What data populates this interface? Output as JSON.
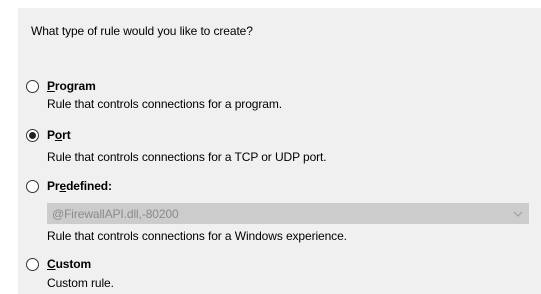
{
  "question": "What type of rule would you like to create?",
  "options": [
    {
      "id": "program",
      "label_prefix": "",
      "label_accel": "P",
      "label_rest": "rogram",
      "description": "Rule that controls connections for a program.",
      "selected": false
    },
    {
      "id": "port",
      "label_prefix": "P",
      "label_accel": "o",
      "label_rest": "rt",
      "description": "Rule that controls connections for a TCP or UDP port.",
      "selected": true
    },
    {
      "id": "predefined",
      "label_prefix": "Pr",
      "label_accel": "e",
      "label_rest": "defined:",
      "description": "Rule that controls connections for a Windows experience.",
      "selected": false
    },
    {
      "id": "custom",
      "label_prefix": "",
      "label_accel": "C",
      "label_rest": "ustom",
      "description": "Custom rule.",
      "selected": false
    }
  ],
  "predefined_select": {
    "value": "@FirewallAPI.dll,-80200",
    "enabled": false
  },
  "icons": {
    "dropdown": "chevron-down-icon",
    "radio": "radio-button"
  },
  "colors": {
    "panel_bg": "#f0f0f0",
    "disabled_select_bg": "#cccccc",
    "disabled_text": "#8a8a8a"
  }
}
